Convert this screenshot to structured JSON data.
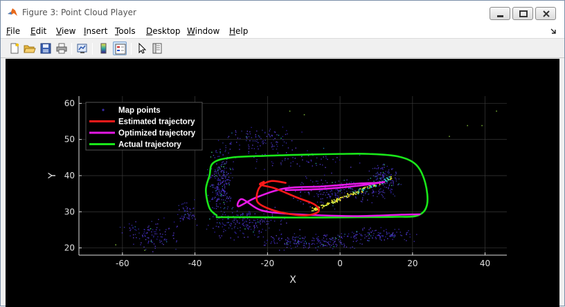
{
  "window": {
    "title": "Figure 3: Point Cloud Player"
  },
  "menu": [
    "File",
    "Edit",
    "View",
    "Insert",
    "Tools",
    "Desktop",
    "Window",
    "Help"
  ],
  "toolbar": [
    {
      "icon": "new-figure-icon"
    },
    {
      "icon": "open-file-icon"
    },
    {
      "icon": "save-icon"
    },
    {
      "icon": "print-icon"
    },
    {
      "icon": "link-plot-icon"
    },
    {
      "icon": "colorbar-icon"
    },
    {
      "icon": "legend-icon",
      "pressed": true
    },
    {
      "icon": "pointer-icon"
    },
    {
      "icon": "property-inspector-icon"
    }
  ],
  "colors": {
    "estimated": "#ff1a1a",
    "optimized": "#e619e6",
    "actual": "#1ae61a",
    "axis": "#e0e0e0",
    "grid": "#3a3a3a"
  },
  "chart_data": {
    "type": "scatter",
    "xlabel": "X",
    "ylabel": "Y",
    "xlim": [
      -72,
      46
    ],
    "ylim": [
      18,
      62
    ],
    "xticks": [
      -60,
      -40,
      -20,
      0,
      20,
      40
    ],
    "yticks": [
      20,
      30,
      40,
      50,
      60
    ],
    "grid": true,
    "legend_position": "top-left",
    "legend": [
      "Map points",
      "Estimated trajectory",
      "Optimized trajectory",
      "Actual trajectory"
    ],
    "series": [
      {
        "name": "Estimated trajectory",
        "kind": "line",
        "x": [
          -15,
          -19,
          -22,
          -23,
          -22,
          -17,
          -10,
          -6,
          -7,
          -12,
          -18,
          -22,
          -21
        ],
        "y": [
          38,
          38.5,
          37,
          34,
          32,
          30,
          29,
          30,
          32,
          34,
          36.5,
          37.5,
          38.3
        ]
      },
      {
        "name": "Optimized trajectory",
        "kind": "line",
        "x": [
          -15,
          -5,
          5,
          12,
          10,
          5,
          -5,
          -15,
          -23,
          -28,
          -27,
          -22,
          -15,
          -5,
          5,
          12,
          17,
          22
        ],
        "y": [
          36,
          36.3,
          37.2,
          38.2,
          38,
          37.8,
          37,
          36.5,
          34,
          31.5,
          33.5,
          30.5,
          29.5,
          29,
          28.8,
          29,
          29.2,
          29.3
        ]
      },
      {
        "name": "Actual trajectory",
        "kind": "line",
        "x": [
          -34,
          -25,
          -10,
          5,
          15,
          21.5,
          24,
          23.5,
          21,
          16,
          8,
          0,
          -10,
          -20,
          -30,
          -35,
          -36,
          -37,
          -36,
          -34
        ],
        "y": [
          28.5,
          28.5,
          28.4,
          28.5,
          28.6,
          29,
          32,
          38,
          43,
          45.3,
          46,
          46,
          45.8,
          45.5,
          45,
          43.5,
          40,
          36,
          31,
          29
        ]
      }
    ]
  }
}
